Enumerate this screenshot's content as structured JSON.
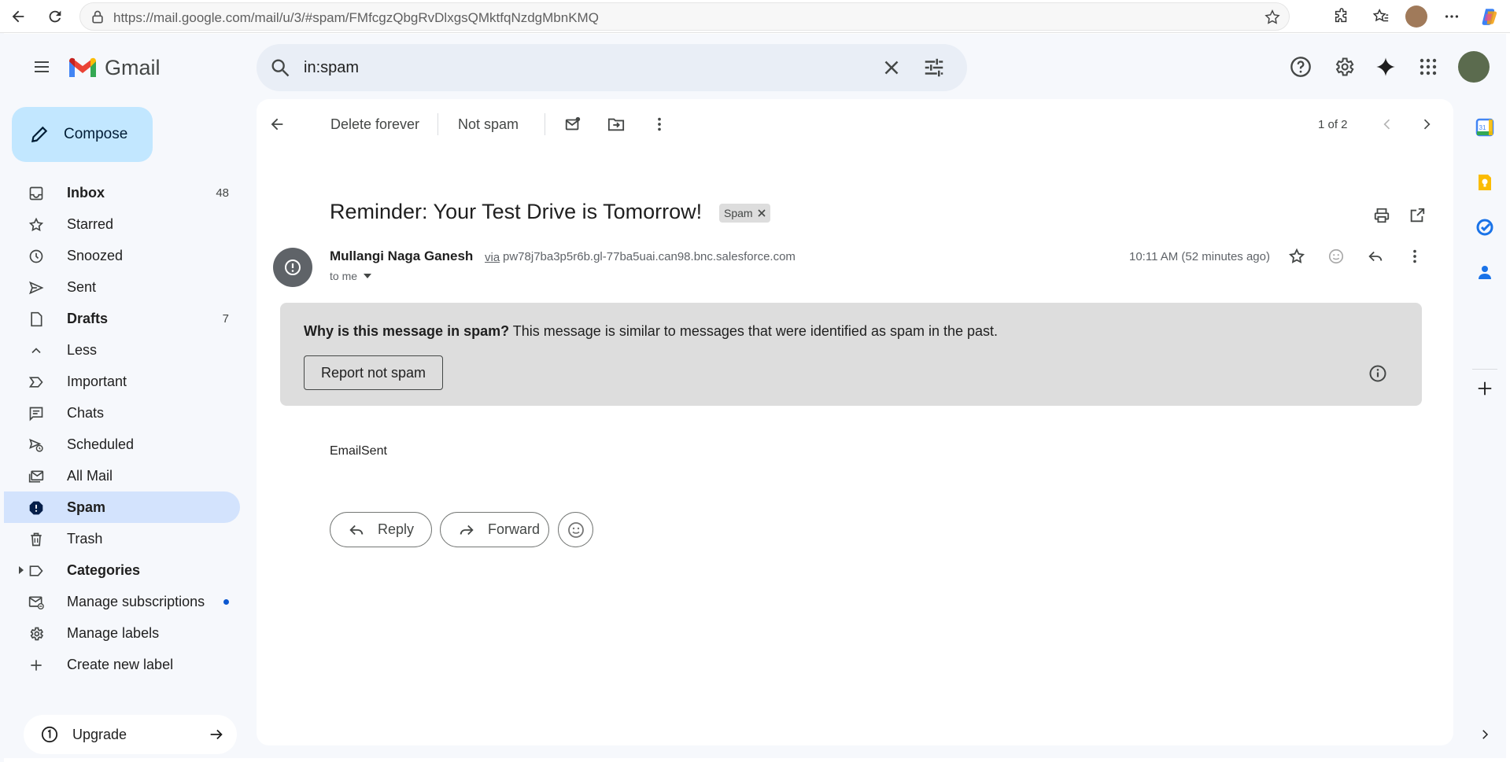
{
  "browser": {
    "url": "https://mail.google.com/mail/u/3/#spam/FMfcgzQbgRvDlxgsQMktfqNzdgMbnKMQ"
  },
  "app": {
    "name": "Gmail"
  },
  "search": {
    "value": "in:spam",
    "placeholder": "Search mail"
  },
  "sidebar": {
    "compose_label": "Compose",
    "items": [
      {
        "label": "Inbox",
        "count": "48",
        "bold": true
      },
      {
        "label": "Starred",
        "count": ""
      },
      {
        "label": "Snoozed",
        "count": ""
      },
      {
        "label": "Sent",
        "count": ""
      },
      {
        "label": "Drafts",
        "count": "7",
        "bold": true
      },
      {
        "label": "Less",
        "count": ""
      },
      {
        "label": "Important",
        "count": ""
      },
      {
        "label": "Chats",
        "count": ""
      },
      {
        "label": "Scheduled",
        "count": ""
      },
      {
        "label": "All Mail",
        "count": ""
      },
      {
        "label": "Spam",
        "count": "",
        "active": true
      },
      {
        "label": "Trash",
        "count": ""
      },
      {
        "label": "Categories",
        "count": "",
        "bold": true
      },
      {
        "label": "Manage subscriptions",
        "count": ""
      },
      {
        "label": "Manage labels",
        "count": ""
      },
      {
        "label": "Create new label",
        "count": ""
      }
    ],
    "upgrade_label": "Upgrade"
  },
  "toolbar": {
    "delete_forever": "Delete forever",
    "not_spam": "Not spam",
    "pager": "1 of 2"
  },
  "message": {
    "subject": "Reminder: Your Test Drive is Tomorrow!",
    "label_chip": "Spam",
    "sender_name": "Mullangi Naga Ganesh",
    "via": "via",
    "via_address": "pw78j7ba3p5r6b.gl-77ba5uai.can98.bnc.salesforce.com",
    "to": "to me",
    "time": "10:11 AM (52 minutes ago)",
    "body": "EmailSent"
  },
  "spam_banner": {
    "question": "Why is this message in spam?",
    "explanation": " This message is similar to messages that were identified as spam in the past.",
    "report_button": "Report not spam"
  },
  "actions": {
    "reply": "Reply",
    "forward": "Forward"
  },
  "colors": {
    "compose_bg": "#c2e7ff",
    "active_nav_bg": "#d3e3fd",
    "banner_bg": "#dddddd",
    "accent_blue": "#0b57d0"
  }
}
